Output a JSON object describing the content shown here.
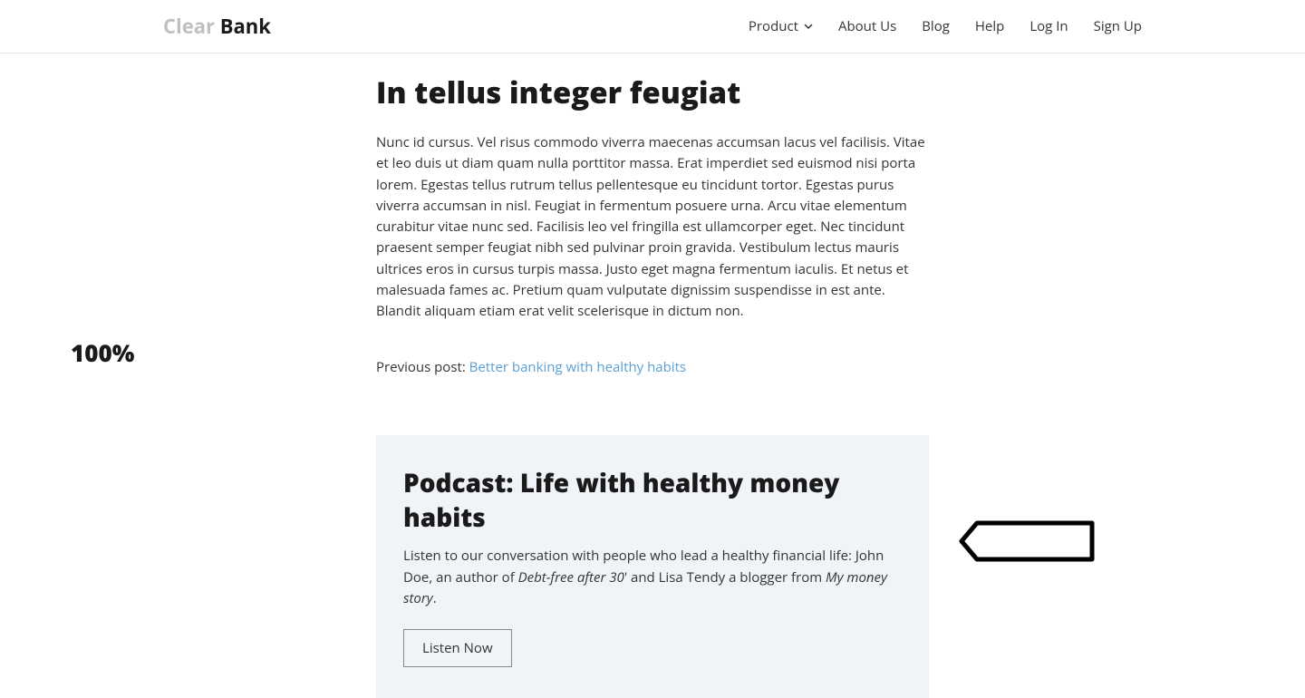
{
  "logo": {
    "clear": "Clear",
    "bank": " Bank"
  },
  "nav": {
    "product": "Product",
    "about": "About Us",
    "blog": "Blog",
    "help": "Help",
    "login": "Log In",
    "signup": "Sign Up"
  },
  "article": {
    "heading": "In tellus integer feugiat",
    "body": "Nunc id cursus. Vel risus commodo viverra maecenas accumsan lacus vel facilisis. Vitae et leo duis ut diam quam nulla porttitor massa. Erat imperdiet sed euismod nisi porta lorem. Egestas tellus rutrum tellus pellentesque eu tincidunt tortor. Egestas purus viverra accumsan in nisl. Feugiat in fermentum posuere urna. Arcu vitae elementum curabitur vitae nunc sed. Facilisis leo vel fringilla est ullamcorper eget. Nec tincidunt praesent semper feugiat nibh sed pulvinar proin gravida. Vestibulum lectus mauris ultrices eros in cursus turpis massa. Justo eget magna fermentum iaculis. Et netus et malesuada fames ac. Pretium quam vulputate dignissim suspendisse in est ante. Blandit aliquam etiam erat velit scelerisque in dictum non."
  },
  "prev": {
    "label": "Previous post: ",
    "link_text": "Better banking with healthy habits"
  },
  "podcast": {
    "title": "Podcast: Life with healthy money habits",
    "desc_1": "Listen to our conversation with people who lead a healthy financial life: John Doe, an author of ",
    "em_1": "Debt-free after 30",
    "desc_2": "' and Lisa Tendy a blogger from ",
    "em_2": "My money story",
    "desc_3": ".",
    "button": "Listen Now"
  },
  "annotations": {
    "percent": "100%"
  }
}
